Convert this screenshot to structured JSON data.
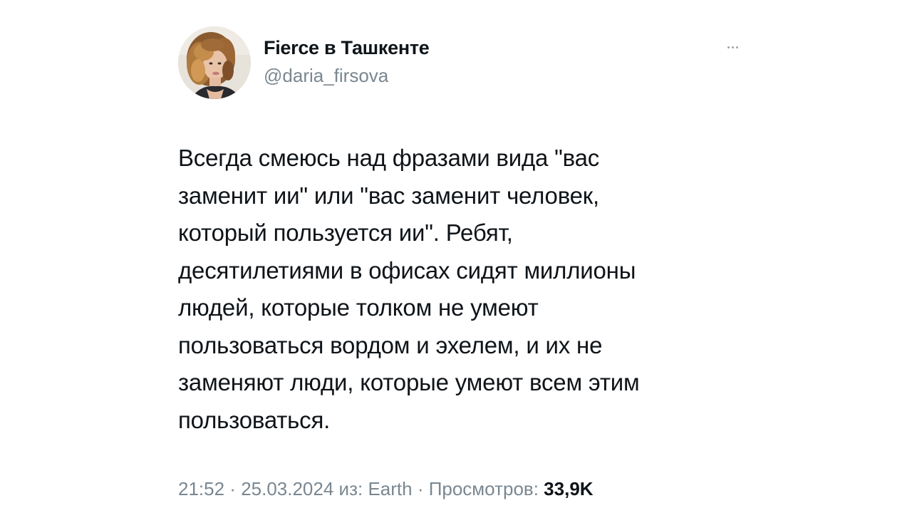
{
  "author": {
    "display_name": "Fierce в Ташкенте",
    "handle": "@daria_firsova",
    "avatar_icon": "user-avatar-photo"
  },
  "menu": {
    "icon": "more-horizontal-icon"
  },
  "tweet": {
    "lines": [
      "Всегда смеюсь над фразами вида \"вас",
      "заменит ии\" или \"вас заменит человек,",
      "который пользуется ии\". Ребят,",
      "десятилетиями в офисах сидят миллионы",
      "людей, которые толком не умеют",
      "пользоваться вордом и эхелем, и их не",
      "заменяют люди, которые умеют всем этим",
      "пользоваться."
    ]
  },
  "meta": {
    "time": "21:52",
    "sep1": " · ",
    "date": "25.03.2024",
    "source": " из: Earth",
    "sep2": " · ",
    "views_label": "Просмотров: ",
    "views_count": "33,9K"
  },
  "colors": {
    "text": "#0f1419",
    "secondary": "#7a8791",
    "background": "#ffffff"
  }
}
